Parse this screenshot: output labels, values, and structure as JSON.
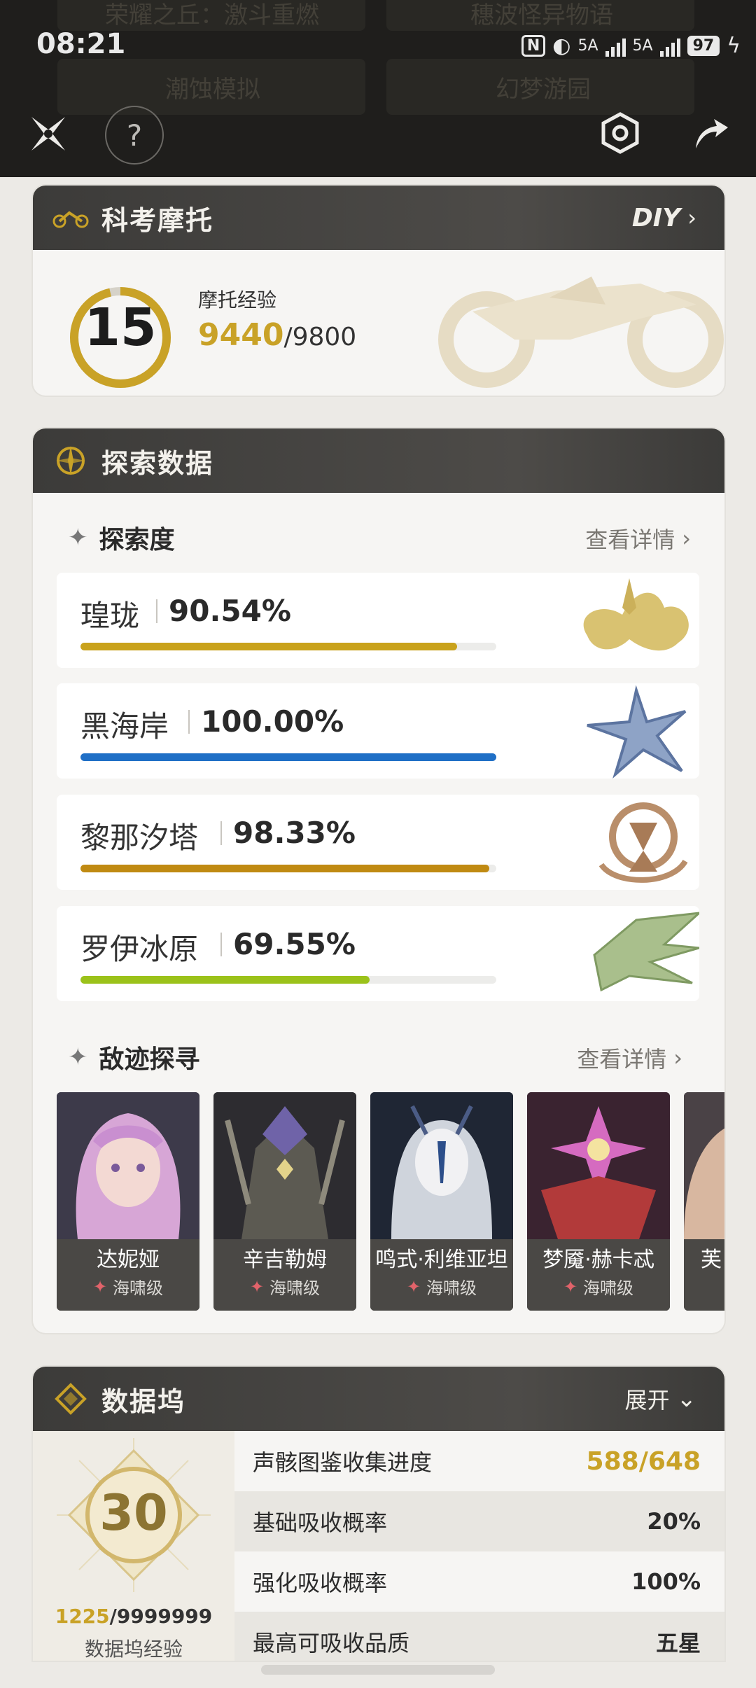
{
  "status_bar": {
    "time": "08:21",
    "network_1": "5A",
    "network_2": "5A",
    "battery": "97"
  },
  "background_menu": {
    "items": [
      "荣耀之丘：激斗重燃",
      "穗波怪异物语",
      "潮蚀模拟",
      "幻梦游园"
    ]
  },
  "moto_card": {
    "title": "科考摩托",
    "diy_label": "DIY",
    "level": "15",
    "exp_label": "摩托经验",
    "exp_current": "9440",
    "exp_max": "/9800"
  },
  "explore_card": {
    "title": "探索数据",
    "section_title": "探索度",
    "more_label": "查看详情",
    "regions": [
      {
        "name": "瑝珑",
        "percent": "90.54%",
        "progress": 0.9054,
        "color": "#c9a21c"
      },
      {
        "name": "黑海岸",
        "percent": "100.00%",
        "progress": 1.0,
        "color": "#1f6fc6"
      },
      {
        "name": "黎那汐塔",
        "percent": "98.33%",
        "progress": 0.9833,
        "color": "#c08a12"
      },
      {
        "name": "罗伊冰原",
        "percent": "69.55%",
        "progress": 0.6955,
        "color": "#9bc21a"
      }
    ],
    "enemy_section_title": "敌迹探寻",
    "enemy_more_label": "查看详情",
    "enemies": [
      {
        "name": "达妮娅",
        "rank": "海啸级"
      },
      {
        "name": "辛吉勒姆",
        "rank": "海啸级"
      },
      {
        "name": "鸣式·利维亚坦",
        "rank": "海啸级"
      },
      {
        "name": "梦魇·赫卡忒",
        "rank": "海啸级"
      },
      {
        "name": "芙",
        "rank": ""
      }
    ]
  },
  "dock_card": {
    "title": "数据坞",
    "expand_label": "展开",
    "level": "30",
    "exp_current": "1225",
    "exp_max": "/9999999",
    "exp_label": "数据坞经验",
    "rows": [
      {
        "label": "声骸图鉴收集进度",
        "value": "588/648"
      },
      {
        "label": "基础吸收概率",
        "value": "20%"
      },
      {
        "label": "强化吸收概率",
        "value": "100%"
      },
      {
        "label": "最高可吸收品质",
        "value": "五星"
      }
    ]
  },
  "colors": {
    "gold": "#c9a227",
    "header_dark": "#1f1e1c",
    "card_head": "#45433f"
  }
}
